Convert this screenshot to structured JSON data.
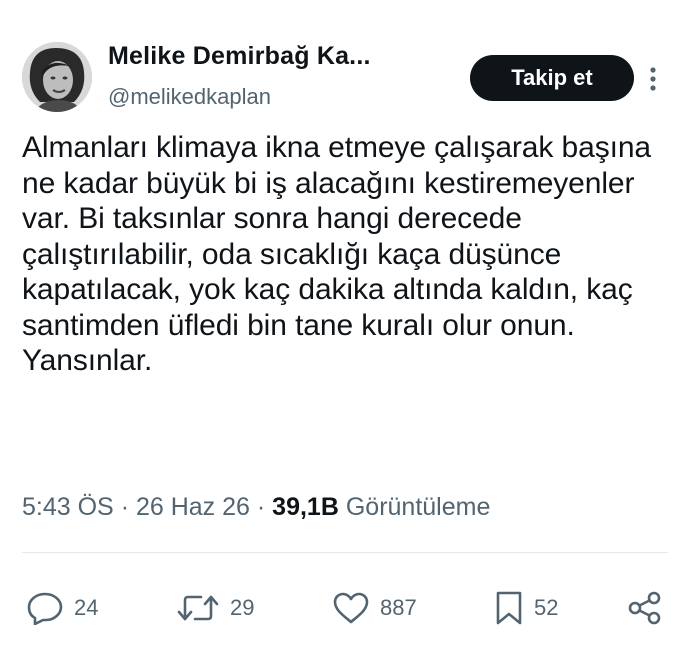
{
  "user": {
    "display_name": "Melike Demirbağ Ka...",
    "handle": "@melikedkaplan"
  },
  "follow_label": "Takip et",
  "tweet_text": "Almanları klimaya ikna etmeye çalışarak başına ne kadar büyük bi iş alacağını kestiremeyenler var. Bi taksınlar sonra hangi derecede çalıştırılabilir, oda sıcaklığı kaça düşünce kapatılacak, yok kaç dakika altında kaldın, kaç santimden üfledi bin tane kuralı olur onun. Yansınlar.",
  "meta": {
    "time": "5:43 ÖS",
    "separator": "·",
    "date": "26 Haz 26",
    "views_count": "39,1B",
    "views_label": "Görüntüleme"
  },
  "actions": {
    "replies": "24",
    "retweets": "29",
    "likes": "887",
    "bookmarks": "52"
  }
}
